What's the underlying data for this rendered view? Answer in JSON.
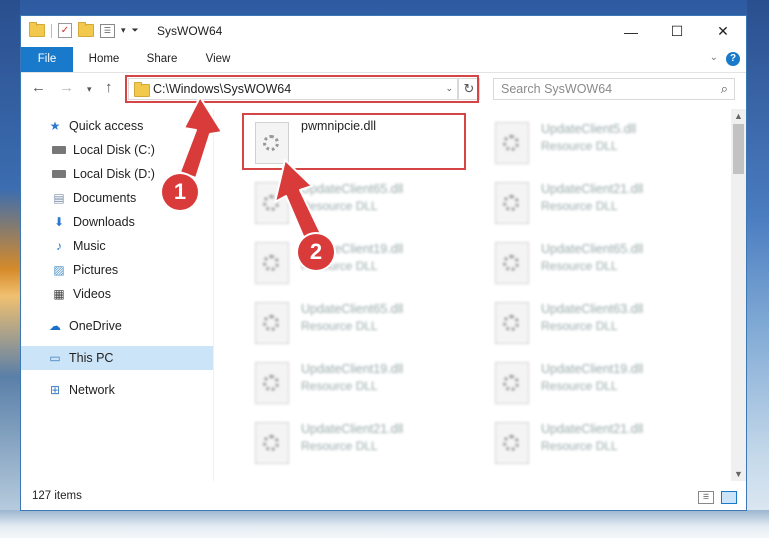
{
  "window": {
    "title": "SysWOW64",
    "controls": {
      "minimize": "—",
      "maximize": "☐",
      "close": "✕"
    }
  },
  "ribbon": {
    "tabs": [
      "File",
      "Home",
      "Share",
      "View"
    ],
    "accent": "#1979ca"
  },
  "address": {
    "path": "C:\\Windows\\SysWOW64",
    "search_placeholder": "Search SysWOW64"
  },
  "nav": {
    "items": [
      {
        "label": "Quick access",
        "icon": "star-icon"
      },
      {
        "label": "Local Disk (C:)",
        "icon": "drive-icon",
        "pinned": true
      },
      {
        "label": "Local Disk (D:)",
        "icon": "drive-icon",
        "pinned": true
      },
      {
        "label": "Documents",
        "icon": "documents-icon",
        "pinned": true
      },
      {
        "label": "Downloads",
        "icon": "downloads-icon",
        "pinned": true
      },
      {
        "label": "Music",
        "icon": "music-icon",
        "pinned": true
      },
      {
        "label": "Pictures",
        "icon": "pictures-icon",
        "pinned": true
      },
      {
        "label": "Videos",
        "icon": "videos-icon",
        "pinned": true
      },
      {
        "label": "OneDrive",
        "icon": "cloud-icon"
      },
      {
        "label": "This PC",
        "icon": "computer-icon",
        "selected": true
      },
      {
        "label": "Network",
        "icon": "network-icon"
      }
    ]
  },
  "files": [
    {
      "name": "pwmnipcie.dll",
      "type": "",
      "highlighted": true
    },
    {
      "name": "UpdateClient5.dll",
      "type": "Resource DLL"
    },
    {
      "name": "UpdateClient65.dll",
      "type": "Resource DLL"
    },
    {
      "name": "UpdateClient21.dll",
      "type": "Resource DLL"
    },
    {
      "name": "UpdateClient19.dll",
      "type": "Resource DLL"
    },
    {
      "name": "UpdateClient65.dll",
      "type": "Resource DLL"
    },
    {
      "name": "UpdateClient65.dll",
      "type": "Resource DLL"
    },
    {
      "name": "UpdateClient63.dll",
      "type": "Resource DLL"
    },
    {
      "name": "UpdateClient19.dll",
      "type": "Resource DLL"
    },
    {
      "name": "UpdateClient19.dll",
      "type": "Resource DLL"
    },
    {
      "name": "UpdateClient21.dll",
      "type": "Resource DLL"
    },
    {
      "name": "UpdateClient21.dll",
      "type": "Resource DLL"
    }
  ],
  "status": {
    "item_count": "127 items"
  },
  "annotations": {
    "badge1": "1",
    "badge2": "2",
    "color": "#d64545"
  }
}
